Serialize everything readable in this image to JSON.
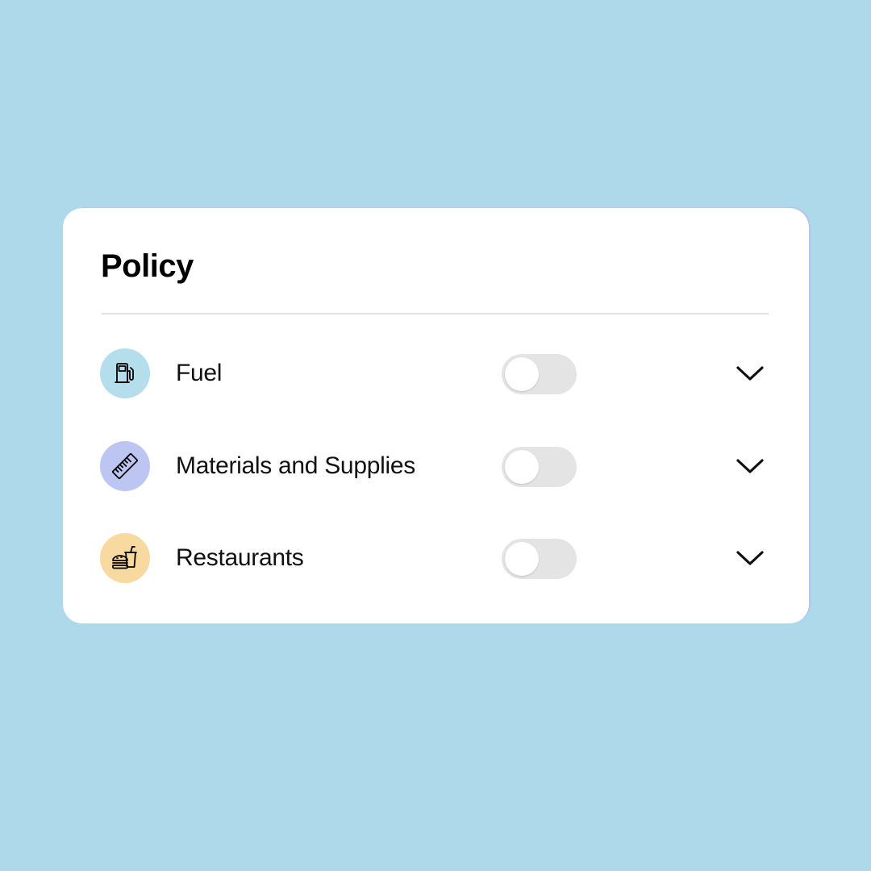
{
  "page": {
    "background_color": "#add9ea"
  },
  "card": {
    "title": "Policy",
    "items": [
      {
        "label": "Fuel",
        "icon": "fuel-pump-icon",
        "icon_bg": "#b4deec",
        "enabled": false
      },
      {
        "label": "Materials and Supplies",
        "icon": "ruler-icon",
        "icon_bg": "#bdc6f3",
        "enabled": false
      },
      {
        "label": "Restaurants",
        "icon": "fast-food-icon",
        "icon_bg": "#f8d9a0",
        "enabled": false
      }
    ]
  }
}
